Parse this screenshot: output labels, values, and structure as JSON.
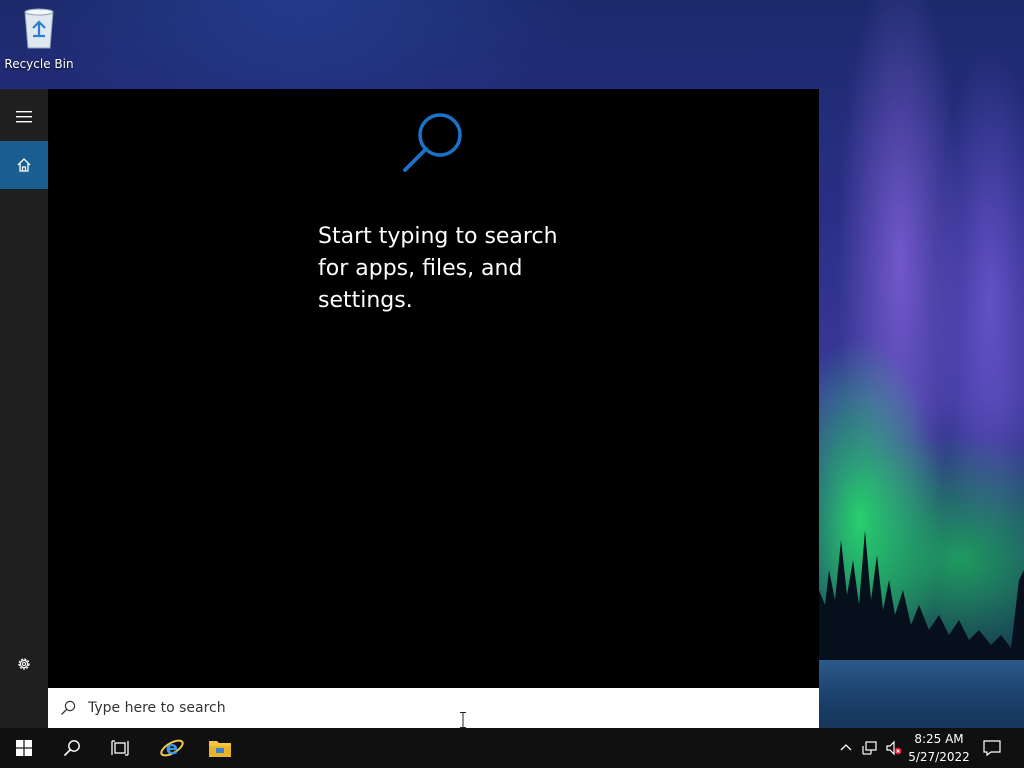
{
  "desktop": {
    "icons": [
      {
        "label": "Recycle Bin",
        "icon": "recycle-bin-icon"
      }
    ]
  },
  "search_panel": {
    "rail": {
      "menu_icon": "hamburger-menu-icon",
      "home_icon": "home-icon",
      "settings_icon": "gear-icon"
    },
    "empty_state": {
      "icon": "search-icon",
      "line1": "Start typing to search",
      "line2": "for apps, files, and",
      "line3": "settings."
    },
    "search_box": {
      "placeholder": "Type here to search",
      "value": ""
    }
  },
  "taskbar": {
    "pinned": [
      {
        "name": "start",
        "icon": "windows-logo-icon"
      },
      {
        "name": "search",
        "icon": "search-icon"
      },
      {
        "name": "task-view",
        "icon": "task-view-icon"
      },
      {
        "name": "internet-explorer",
        "icon": "internet-explorer-icon"
      },
      {
        "name": "file-explorer",
        "icon": "folder-icon"
      }
    ],
    "tray": {
      "icons": [
        "chevron-up-icon",
        "network-icon",
        "volume-muted-icon",
        "notification-icon"
      ],
      "time": "8:25 AM",
      "date": "5/27/2022"
    }
  },
  "colors": {
    "accent": "#1b5e92",
    "search_icon_blue": "#1a73c8",
    "taskbar": "#101010",
    "panel": "#000000",
    "rail": "#1f1f1f"
  }
}
